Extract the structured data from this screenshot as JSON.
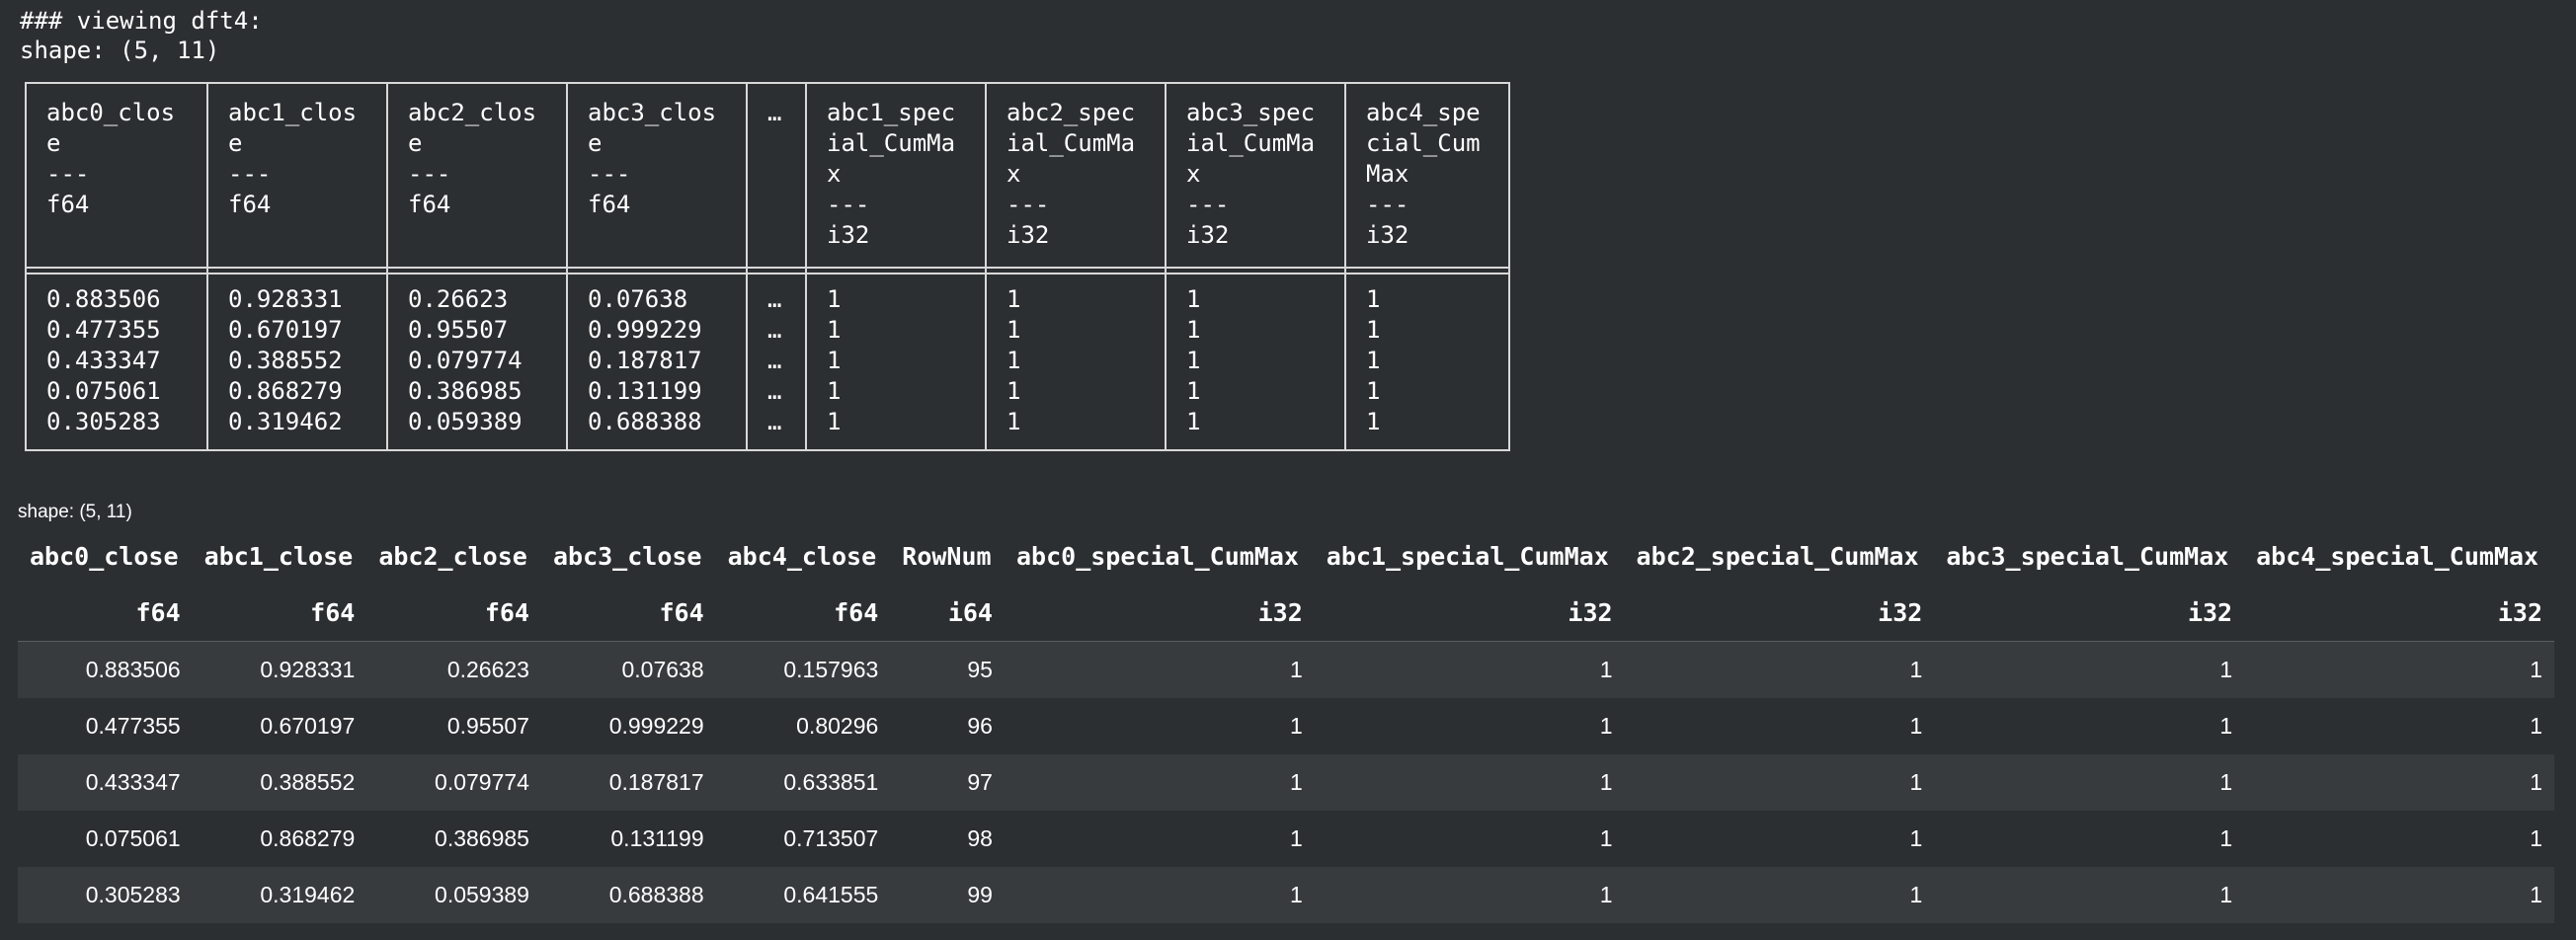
{
  "print_output": {
    "title_line": "### viewing dft4:",
    "shape_line": "shape: (5, 11)"
  },
  "ascii_table": {
    "columns": [
      {
        "name_lines": "abc0_clos\ne",
        "sep": "---",
        "dtype": "f64",
        "values": [
          "0.883506",
          "0.477355",
          "0.433347",
          "0.075061",
          "0.305283"
        ]
      },
      {
        "name_lines": "abc1_clos\ne",
        "sep": "---",
        "dtype": "f64",
        "values": [
          "0.928331",
          "0.670197",
          "0.388552",
          "0.868279",
          "0.319462"
        ]
      },
      {
        "name_lines": "abc2_clos\ne",
        "sep": "---",
        "dtype": "f64",
        "values": [
          "0.26623",
          "0.95507",
          "0.079774",
          "0.386985",
          "0.059389"
        ]
      },
      {
        "name_lines": "abc3_clos\ne",
        "sep": "---",
        "dtype": "f64",
        "values": [
          "0.07638",
          "0.999229",
          "0.187817",
          "0.131199",
          "0.688388"
        ]
      },
      {
        "name_lines": "…",
        "sep": "",
        "dtype": "",
        "values": [
          "…",
          "…",
          "…",
          "…",
          "…"
        ]
      },
      {
        "name_lines": "abc1_spec\nial_CumMa\nx",
        "sep": "---",
        "dtype": "i32",
        "values": [
          "1",
          "1",
          "1",
          "1",
          "1"
        ]
      },
      {
        "name_lines": "abc2_spec\nial_CumMa\nx",
        "sep": "---",
        "dtype": "i32",
        "values": [
          "1",
          "1",
          "1",
          "1",
          "1"
        ]
      },
      {
        "name_lines": "abc3_spec\nial_CumMa\nx",
        "sep": "---",
        "dtype": "i32",
        "values": [
          "1",
          "1",
          "1",
          "1",
          "1"
        ]
      },
      {
        "name_lines": "abc4_spe\ncial_Cum\nMax",
        "sep": "---",
        "dtype": "i32",
        "values": [
          "1",
          "1",
          "1",
          "1",
          "1"
        ]
      }
    ]
  },
  "html_table": {
    "shape_label": "shape: (5, 11)",
    "columns": [
      "abc0_close",
      "abc1_close",
      "abc2_close",
      "abc3_close",
      "abc4_close",
      "RowNum",
      "abc0_special_CumMax",
      "abc1_special_CumMax",
      "abc2_special_CumMax",
      "abc3_special_CumMax",
      "abc4_special_CumMax"
    ],
    "dtypes": [
      "f64",
      "f64",
      "f64",
      "f64",
      "f64",
      "i64",
      "i32",
      "i32",
      "i32",
      "i32",
      "i32"
    ],
    "rows": [
      [
        "0.883506",
        "0.928331",
        "0.26623",
        "0.07638",
        "0.157963",
        "95",
        "1",
        "1",
        "1",
        "1",
        "1"
      ],
      [
        "0.477355",
        "0.670197",
        "0.95507",
        "0.999229",
        "0.80296",
        "96",
        "1",
        "1",
        "1",
        "1",
        "1"
      ],
      [
        "0.433347",
        "0.388552",
        "0.079774",
        "0.187817",
        "0.633851",
        "97",
        "1",
        "1",
        "1",
        "1",
        "1"
      ],
      [
        "0.075061",
        "0.868279",
        "0.386985",
        "0.131199",
        "0.713507",
        "98",
        "1",
        "1",
        "1",
        "1",
        "1"
      ],
      [
        "0.305283",
        "0.319462",
        "0.059389",
        "0.688388",
        "0.641555",
        "99",
        "1",
        "1",
        "1",
        "1",
        "1"
      ]
    ]
  },
  "colors": {
    "background": "#2c2f31",
    "row_stripe": "#383b3d",
    "border": "#d8d8d8",
    "text": "#ffffff"
  }
}
